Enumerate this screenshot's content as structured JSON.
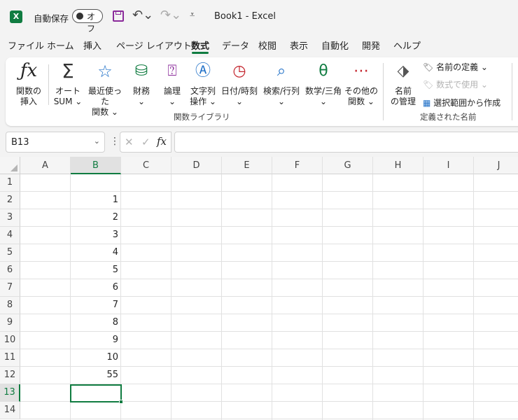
{
  "titlebar": {
    "app_icon": "X",
    "autosave_label": "自動保存",
    "autosave_state": "オフ",
    "undo_glyph": "↶⌄",
    "redo_glyph": "↷⌄",
    "qat_more": "⩡",
    "doc_title": "Book1  -  Excel"
  },
  "tabs": [
    "ファイル",
    "ホーム",
    "挿入",
    "ページ レイアウト",
    "数式",
    "データ",
    "校閲",
    "表示",
    "自動化",
    "開発",
    "ヘルプ"
  ],
  "active_tab": "数式",
  "ribbon": {
    "insert_function": {
      "l1": "関数の",
      "l2": "挿入"
    },
    "autosum": {
      "l1": "オート",
      "l2": "SUM ⌄"
    },
    "recent": {
      "l1": "最近使った",
      "l2": "関数 ⌄"
    },
    "financial": {
      "l1": "財務",
      "l2": "⌄"
    },
    "logical": {
      "l1": "論理",
      "l2": "⌄"
    },
    "text": {
      "l1": "文字列",
      "l2": "操作 ⌄"
    },
    "datetime": {
      "l1": "日付/時刻",
      "l2": "⌄"
    },
    "lookup": {
      "l1": "検索/行列",
      "l2": "⌄"
    },
    "math": {
      "l1": "数学/三角",
      "l2": "⌄"
    },
    "more": {
      "l1": "その他の",
      "l2": "関数 ⌄"
    },
    "group1_label": "関数ライブラリ",
    "name_manager": {
      "l1": "名前",
      "l2": "の管理"
    },
    "define_name": "名前の定義  ⌄",
    "use_in_formula": "数式で使用 ⌄",
    "create_from_selection": "選択範囲から作成",
    "group2_label": "定義された名前"
  },
  "formula_bar": {
    "name_box": "B13",
    "cancel": "✕",
    "enter": "✓",
    "fx": "fx",
    "value": ""
  },
  "columns": [
    "A",
    "B",
    "C",
    "D",
    "E",
    "F",
    "G",
    "H",
    "I",
    "J"
  ],
  "rows": [
    "1",
    "2",
    "3",
    "4",
    "5",
    "6",
    "7",
    "8",
    "9",
    "10",
    "11",
    "12",
    "13",
    "14"
  ],
  "selected_cell": "B13",
  "cells_B": [
    "",
    "1",
    "2",
    "3",
    "4",
    "5",
    "6",
    "7",
    "8",
    "9",
    "10",
    "55",
    "",
    ""
  ]
}
